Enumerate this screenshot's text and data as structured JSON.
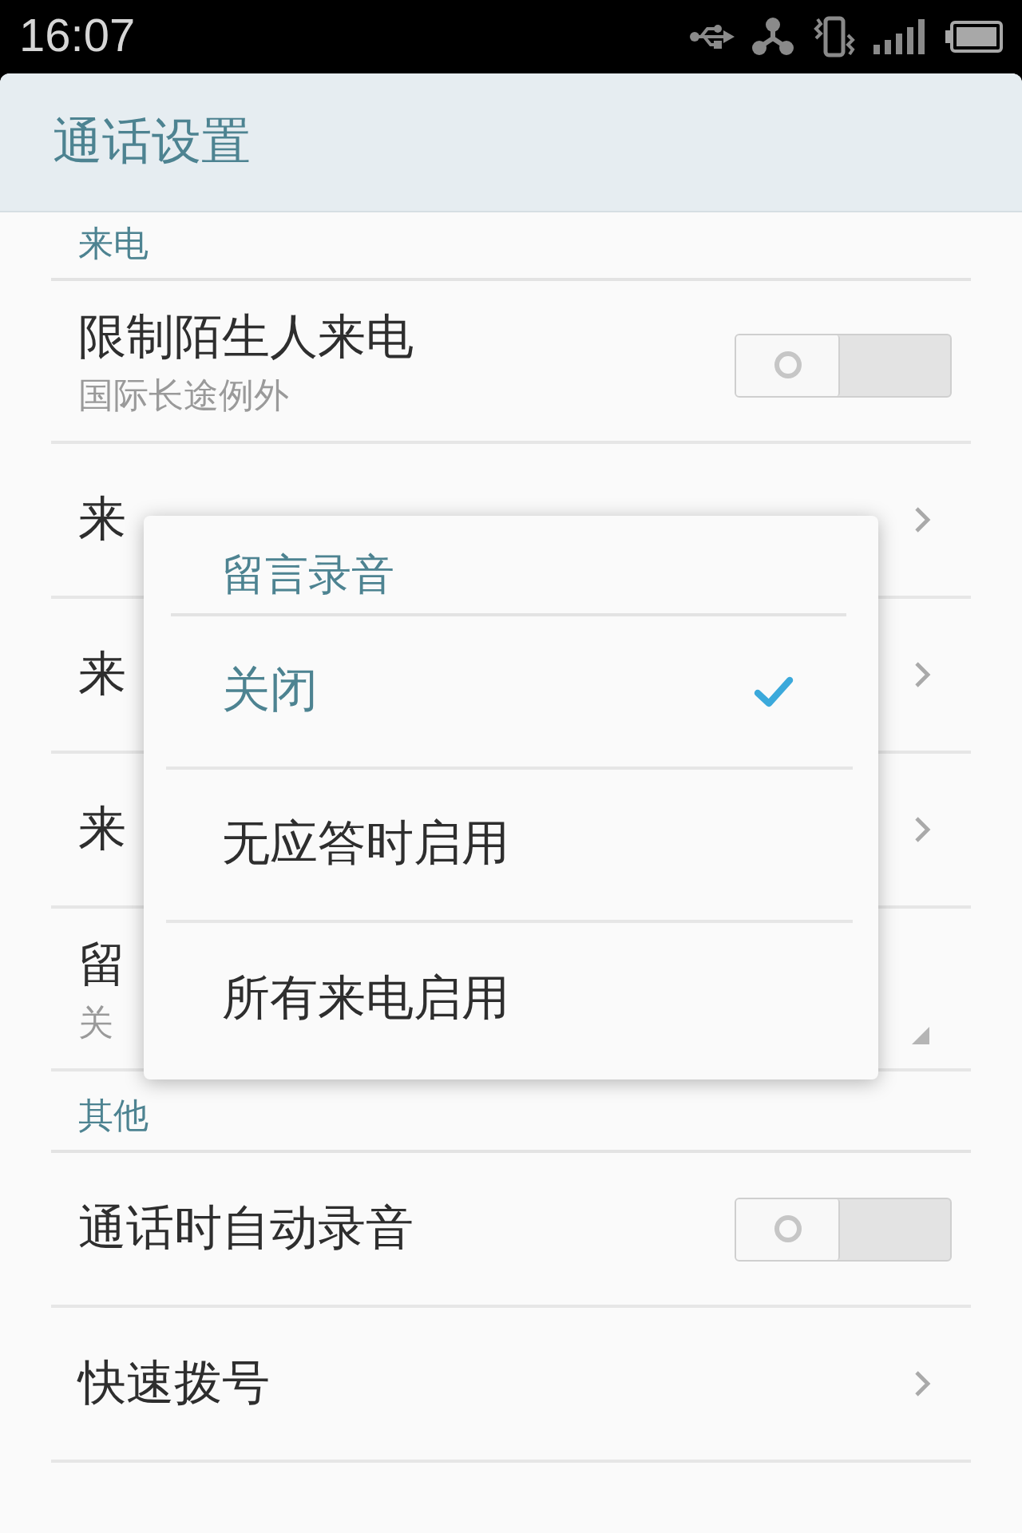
{
  "status_bar": {
    "time": "16:07"
  },
  "header": {
    "title": "通话设置"
  },
  "sections": [
    {
      "title": "来电",
      "items": [
        {
          "kind": "switch",
          "label": "限制陌生人来电",
          "summary": "国际长途例外",
          "on": false
        },
        {
          "kind": "link",
          "label": "来"
        },
        {
          "kind": "link",
          "label": "来"
        },
        {
          "kind": "link",
          "label": "来"
        },
        {
          "kind": "select",
          "label": "留",
          "summary": "关"
        }
      ]
    },
    {
      "title": "其他",
      "items": [
        {
          "kind": "switch",
          "label": "通话时自动录音",
          "on": false
        },
        {
          "kind": "link",
          "label": "快速拨号"
        }
      ]
    }
  ],
  "dialog": {
    "title": "留言录音",
    "options": [
      {
        "label": "关闭",
        "selected": true
      },
      {
        "label": "无应答时启用",
        "selected": false
      },
      {
        "label": "所有来电启用",
        "selected": false
      }
    ]
  }
}
